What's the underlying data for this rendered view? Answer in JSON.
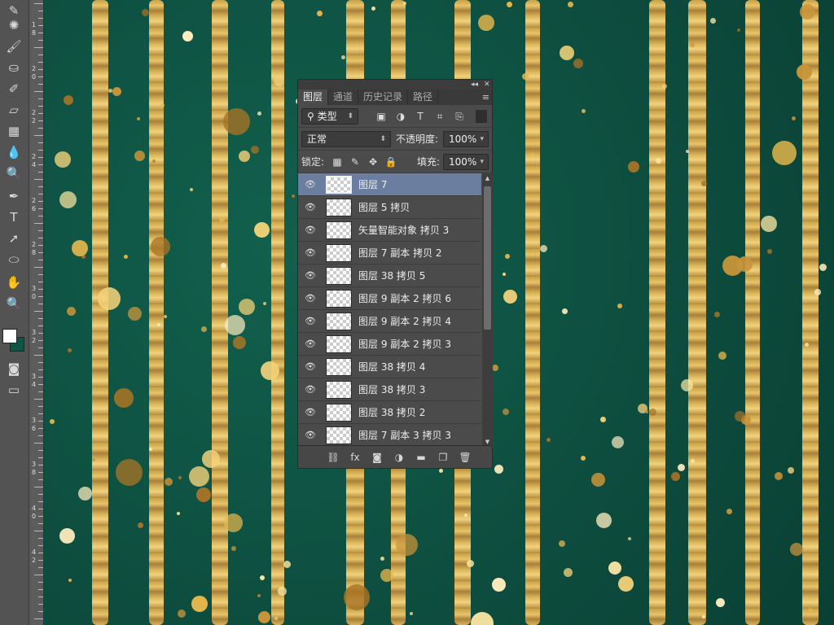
{
  "toolbar": {
    "tools": [
      {
        "name": "brush-tool-icon",
        "glyph": "✎"
      },
      {
        "name": "spot-heal-tool-icon",
        "glyph": "✺"
      },
      {
        "name": "brush-icon",
        "glyph": "🖌"
      },
      {
        "name": "clone-stamp-icon",
        "glyph": "⛀"
      },
      {
        "name": "history-brush-icon",
        "glyph": "✐"
      },
      {
        "name": "eraser-icon",
        "glyph": "▱"
      },
      {
        "name": "gradient-icon",
        "glyph": "▦"
      },
      {
        "name": "blur-icon",
        "glyph": "💧"
      },
      {
        "name": "dodge-icon",
        "glyph": "🔍"
      },
      {
        "name": "pen-tool-icon",
        "glyph": "✒"
      },
      {
        "name": "type-tool-icon",
        "glyph": "T"
      },
      {
        "name": "path-select-icon",
        "glyph": "➚"
      },
      {
        "name": "ellipse-tool-icon",
        "glyph": "⬭"
      },
      {
        "name": "hand-tool-icon",
        "glyph": "✋"
      },
      {
        "name": "zoom-tool-icon",
        "glyph": "🔍"
      }
    ],
    "foreground_color": "#ffffff",
    "background_color": "#0f5546"
  },
  "ruler": {
    "numbers": [
      "1",
      "8",
      "2",
      "0",
      "2",
      "2",
      "2",
      "4",
      "2",
      "6",
      "2",
      "8",
      "3",
      "0",
      "3",
      "2",
      "3",
      "4",
      "3",
      "6",
      "3",
      "8",
      "4",
      "0",
      "4",
      "2"
    ]
  },
  "layers_panel": {
    "tabs": [
      {
        "label": "图层",
        "active": true
      },
      {
        "label": "通道",
        "active": false
      },
      {
        "label": "历史记录",
        "active": false
      },
      {
        "label": "路径",
        "active": false
      }
    ],
    "filter_label": "类型",
    "blend_mode": "正常",
    "opacity_label": "不透明度:",
    "opacity_value": "100%",
    "lock_label": "锁定:",
    "fill_label": "填充:",
    "fill_value": "100%",
    "layers": [
      {
        "name": "图层 7",
        "selected": true
      },
      {
        "name": "图层 5 拷贝",
        "selected": false
      },
      {
        "name": "矢量智能对象 拷贝 3",
        "selected": false
      },
      {
        "name": "图层 7 副本 拷贝 2",
        "selected": false
      },
      {
        "name": "图层 38 拷贝 5",
        "selected": false
      },
      {
        "name": "图层 9 副本 2 拷贝 6",
        "selected": false
      },
      {
        "name": "图层 9 副本 2 拷贝 4",
        "selected": false
      },
      {
        "name": "图层 9 副本 2 拷贝 3",
        "selected": false
      },
      {
        "name": "图层 38 拷贝 4",
        "selected": false
      },
      {
        "name": "图层 38 拷贝 3",
        "selected": false
      },
      {
        "name": "图层 38 拷贝 2",
        "selected": false
      },
      {
        "name": "图层 7 副本 3 拷贝 3",
        "selected": false
      }
    ],
    "footer_icons": [
      "link-icon",
      "fx-icon",
      "mask-icon",
      "adjustment-icon",
      "folder-icon",
      "new-layer-icon",
      "trash-icon"
    ]
  },
  "canvas": {
    "background_color": "#0e4d3f",
    "stripe_color": "#d4ae58",
    "dot_colors": [
      "#f3d27a",
      "#e8b84c",
      "#c9953a",
      "#fbe7a4",
      "#a87426",
      "#ffeec0"
    ]
  }
}
